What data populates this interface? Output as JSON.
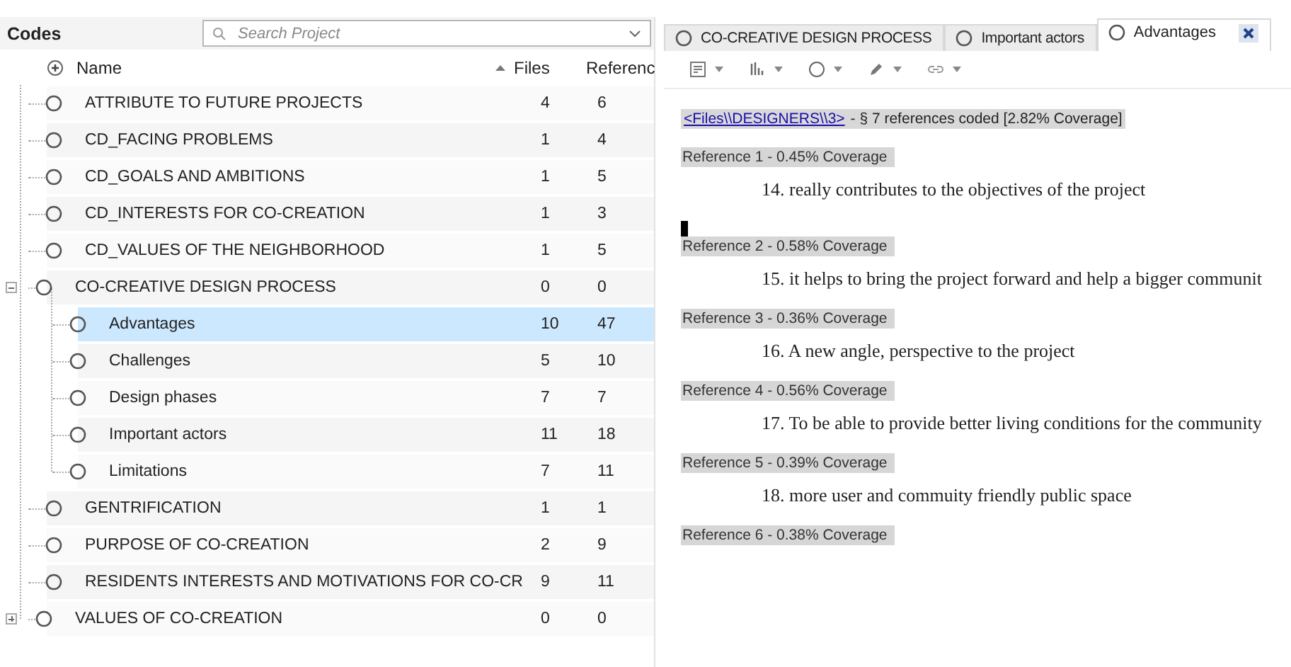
{
  "codes_panel": {
    "title": "Codes",
    "search": {
      "placeholder": "Search Project"
    },
    "columns": [
      {
        "label": "Name",
        "sorted": false
      },
      {
        "label": "Files",
        "sorted": true
      },
      {
        "label": "Referenc",
        "sorted": false
      }
    ],
    "nodes": [
      {
        "name": "ATTRIBUTE TO FUTURE PROJECTS",
        "files": "4",
        "references": "6",
        "selected": false
      },
      {
        "name": "CD_FACING PROBLEMS",
        "files": "1",
        "references": "4",
        "selected": false
      },
      {
        "name": "CD_GOALS AND AMBITIONS",
        "files": "1",
        "references": "5",
        "selected": false
      },
      {
        "name": "CD_INTERESTS FOR CO-CREATION",
        "files": "1",
        "references": "3",
        "selected": false
      },
      {
        "name": "CD_VALUES OF THE NEIGHBORHOOD",
        "files": "1",
        "references": "5",
        "selected": false
      },
      {
        "name": "CO-CREATIVE DESIGN PROCESS",
        "files": "0",
        "references": "0",
        "selected": false,
        "expanded": true,
        "children": [
          {
            "name": "Advantages",
            "files": "10",
            "references": "47",
            "selected": true
          },
          {
            "name": "Challenges",
            "files": "5",
            "references": "10",
            "selected": false
          },
          {
            "name": "Design phases",
            "files": "7",
            "references": "7",
            "selected": false
          },
          {
            "name": "Important actors",
            "files": "11",
            "references": "18",
            "selected": false
          },
          {
            "name": "Limitations",
            "files": "7",
            "references": "11",
            "selected": false
          }
        ]
      },
      {
        "name": "GENTRIFICATION",
        "files": "1",
        "references": "1",
        "selected": false
      },
      {
        "name": "PURPOSE OF CO-CREATION",
        "files": "2",
        "references": "9",
        "selected": false
      },
      {
        "name": "RESIDENTS INTERESTS AND MOTIVATIONS FOR CO-CR",
        "files": "9",
        "references": "11",
        "selected": false
      },
      {
        "name": "VALUES OF CO-CREATION",
        "files": "0",
        "references": "0",
        "selected": false,
        "expanded": false
      }
    ]
  },
  "detail_panel": {
    "tabs": [
      {
        "label": "CO-CREATIVE DESIGN PROCESS",
        "selected": false
      },
      {
        "label": "Important actors",
        "selected": false
      },
      {
        "label": "Advantages",
        "selected": true
      }
    ],
    "source": {
      "link": "<Files\\\\DESIGNERS\\\\3>",
      "summary": "- § 7 references coded  [2.82% Coverage]"
    },
    "references": [
      {
        "label": "Reference 1 - 0.45% Coverage",
        "text": "14. really contributes to the objectives of the project"
      },
      {
        "label": "Reference 2 - 0.58% Coverage",
        "text": "15. it helps to bring the project forward and help a bigger communit"
      },
      {
        "label": "Reference 3 - 0.36% Coverage",
        "text": "16.  A new angle, perspective to the project"
      },
      {
        "label": "Reference 4 - 0.56% Coverage",
        "text": "17. To be able to provide better living conditions for the community"
      },
      {
        "label": "Reference 5 - 0.39% Coverage",
        "text": "18. more user and commuity friendly public space"
      },
      {
        "label": "Reference 6 - 0.38% Coverage"
      }
    ]
  }
}
